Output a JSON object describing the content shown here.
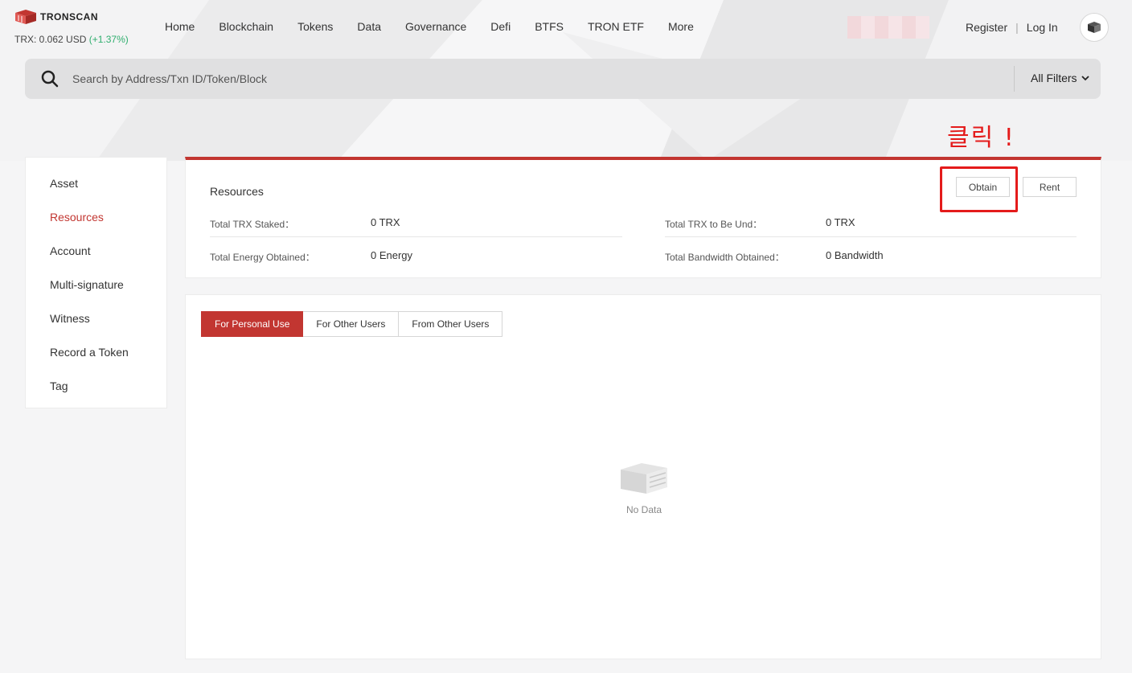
{
  "header": {
    "logo_text": "TRONSCAN",
    "price_label": "TRX: 0.062 USD",
    "price_change": "(+1.37%)",
    "nav": [
      "Home",
      "Blockchain",
      "Tokens",
      "Data",
      "Governance",
      "Defi",
      "BTFS",
      "TRON ETF",
      "More"
    ],
    "register": "Register",
    "separator": "|",
    "login": "Log In"
  },
  "search": {
    "placeholder": "Search by Address/Txn ID/Token/Block",
    "filters_label": "All Filters"
  },
  "annotation": {
    "text": "클릭 !"
  },
  "sidebar": {
    "items": [
      {
        "label": "Asset",
        "active": false
      },
      {
        "label": "Resources",
        "active": true
      },
      {
        "label": "Account",
        "active": false
      },
      {
        "label": "Multi-signature",
        "active": false
      },
      {
        "label": "Witness",
        "active": false
      },
      {
        "label": "Record a Token",
        "active": false
      },
      {
        "label": "Tag",
        "active": false
      }
    ]
  },
  "resources": {
    "title": "Resources",
    "obtain_label": "Obtain",
    "rent_label": "Rent",
    "stats": {
      "trx_staked_label": "Total TRX Staked：",
      "trx_staked_value": "0 TRX",
      "trx_unstaked_label": "Total TRX to Be Und：",
      "trx_unstaked_value": "0 TRX",
      "energy_label": "Total Energy Obtained：",
      "energy_value": "0 Energy",
      "bandwidth_label": "Total Bandwidth Obtained：",
      "bandwidth_value": "0 Bandwidth"
    }
  },
  "tabs": {
    "items": [
      "For Personal Use",
      "For Other Users",
      "From Other Users"
    ],
    "active_index": 0,
    "empty_text": "No Data"
  },
  "colors": {
    "accent": "#c23631",
    "positive": "#2fae6e",
    "annotation": "#e41b1b"
  }
}
